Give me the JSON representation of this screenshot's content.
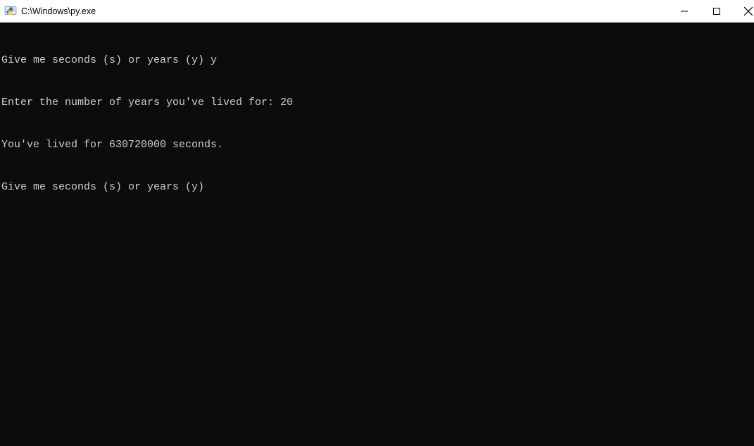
{
  "window": {
    "title": "C:\\Windows\\py.exe"
  },
  "console": {
    "lines": [
      "Give me seconds (s) or years (y) y",
      "Enter the number of years you've lived for: 20",
      "You've lived for 630720000 seconds.",
      "Give me seconds (s) or years (y) "
    ]
  }
}
